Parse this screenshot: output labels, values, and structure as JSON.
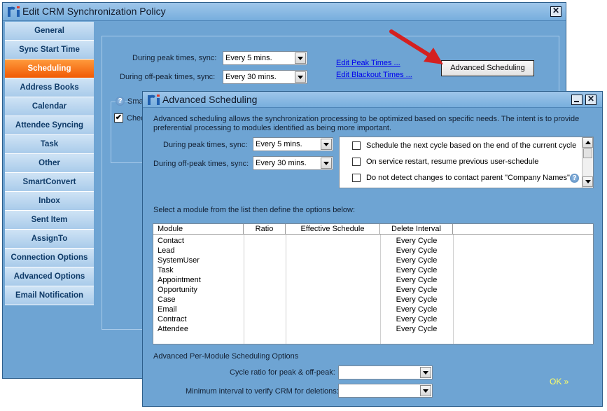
{
  "main_window": {
    "title": "Edit CRM Synchronization Policy",
    "nav_items": [
      {
        "label": "General",
        "active": false
      },
      {
        "label": "Sync Start Time",
        "active": false
      },
      {
        "label": "Scheduling",
        "active": true
      },
      {
        "label": "Address Books",
        "active": false
      },
      {
        "label": "Calendar",
        "active": false
      },
      {
        "label": "Attendee Syncing",
        "active": false
      },
      {
        "label": "Task",
        "active": false
      },
      {
        "label": "Other",
        "active": false
      },
      {
        "label": "SmartConvert",
        "active": false
      },
      {
        "label": "Inbox",
        "active": false
      },
      {
        "label": "Sent Item",
        "active": false
      },
      {
        "label": "AssignTo",
        "active": false
      },
      {
        "label": "Connection Options",
        "active": false
      },
      {
        "label": "Advanced Options",
        "active": false
      },
      {
        "label": "Email Notification",
        "active": false
      }
    ],
    "peak_label": "During peak times, sync:",
    "peak_value": "Every 5 mins.",
    "offpeak_label": "During off-peak times, sync:",
    "offpeak_value": "Every 30 mins.",
    "edit_peak_link": "Edit Peak Times ...",
    "edit_blackout_link": "Edit Blackout Times ...",
    "advanced_button": "Advanced Scheduling",
    "group_label_partial": "Sma",
    "check_label_partial": "Chec"
  },
  "dialog": {
    "title": "Advanced Scheduling",
    "description": "Advanced scheduling allows the synchronization processing to be optimized based on specific needs.  The intent is to provide preferential processing to modules identified as being more important.",
    "peak_label": "During peak times, sync:",
    "peak_value": "Every 5 mins.",
    "offpeak_label": "During off-peak times, sync:",
    "offpeak_value": "Every 30 mins.",
    "options": [
      "Schedule the next cycle based on the end of the current cycle",
      "On service restart, resume previous user-schedule",
      "Do not detect changes to contact parent \"Company Names\""
    ],
    "module_prompt": "Select a module from the list then define the options below:",
    "table": {
      "headers": [
        "Module",
        "Ratio",
        "Effective Schedule",
        "Delete Interval"
      ],
      "rows": [
        [
          "Contact",
          "",
          "",
          "Every Cycle"
        ],
        [
          "Lead",
          "",
          "",
          "Every Cycle"
        ],
        [
          "SystemUser",
          "",
          "",
          "Every Cycle"
        ],
        [
          "Task",
          "",
          "",
          "Every Cycle"
        ],
        [
          "Appointment",
          "",
          "",
          "Every Cycle"
        ],
        [
          "Opportunity",
          "",
          "",
          "Every Cycle"
        ],
        [
          "Case",
          "",
          "",
          "Every Cycle"
        ],
        [
          "Email",
          "",
          "",
          "Every Cycle"
        ],
        [
          "Contract",
          "",
          "",
          "Every Cycle"
        ],
        [
          "Attendee",
          "",
          "",
          "Every Cycle"
        ]
      ]
    },
    "per_module_heading": "Advanced Per-Module Scheduling Options",
    "cycle_ratio_label": "Cycle ratio for peak & off-peak:",
    "cycle_ratio_value": "",
    "min_interval_label": "Minimum interval to verify CRM for deletions:",
    "min_interval_value": "",
    "ok_label": "OK »"
  },
  "colors": {
    "window_bg": "#6ea4d3",
    "active_nav": "#f05a05",
    "arrow": "#d42020"
  }
}
